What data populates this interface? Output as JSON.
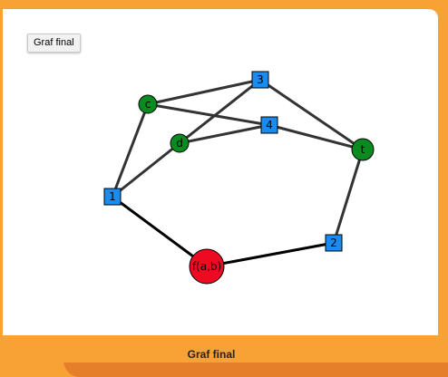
{
  "button": {
    "label": "Graf final"
  },
  "caption": "Graf final",
  "graph": {
    "nodes": [
      {
        "id": "c",
        "label": "c",
        "shape": "circle",
        "color": "#0a8a1f"
      },
      {
        "id": "d",
        "label": "d",
        "shape": "circle",
        "color": "#0a8a1f"
      },
      {
        "id": "t",
        "label": "t",
        "shape": "circle",
        "color": "#0a8a1f"
      },
      {
        "id": "3",
        "label": "3",
        "shape": "square",
        "color": "#1a8cf0"
      },
      {
        "id": "4",
        "label": "4",
        "shape": "square",
        "color": "#1a8cf0"
      },
      {
        "id": "1",
        "label": "1",
        "shape": "square",
        "color": "#1a8cf0"
      },
      {
        "id": "2",
        "label": "2",
        "shape": "square",
        "color": "#1a8cf0"
      },
      {
        "id": "fab",
        "label": "f(a,b)",
        "shape": "big-circle",
        "color": "#ee0a20"
      }
    ],
    "edges": [
      {
        "from": "c",
        "to": "3"
      },
      {
        "from": "c",
        "to": "4"
      },
      {
        "from": "c",
        "to": "1"
      },
      {
        "from": "3",
        "to": "d"
      },
      {
        "from": "3",
        "to": "t"
      },
      {
        "from": "d",
        "to": "4"
      },
      {
        "from": "d",
        "to": "1"
      },
      {
        "from": "4",
        "to": "t"
      },
      {
        "from": "t",
        "to": "2"
      },
      {
        "from": "1",
        "to": "fab"
      },
      {
        "from": "fab",
        "to": "2"
      }
    ]
  }
}
